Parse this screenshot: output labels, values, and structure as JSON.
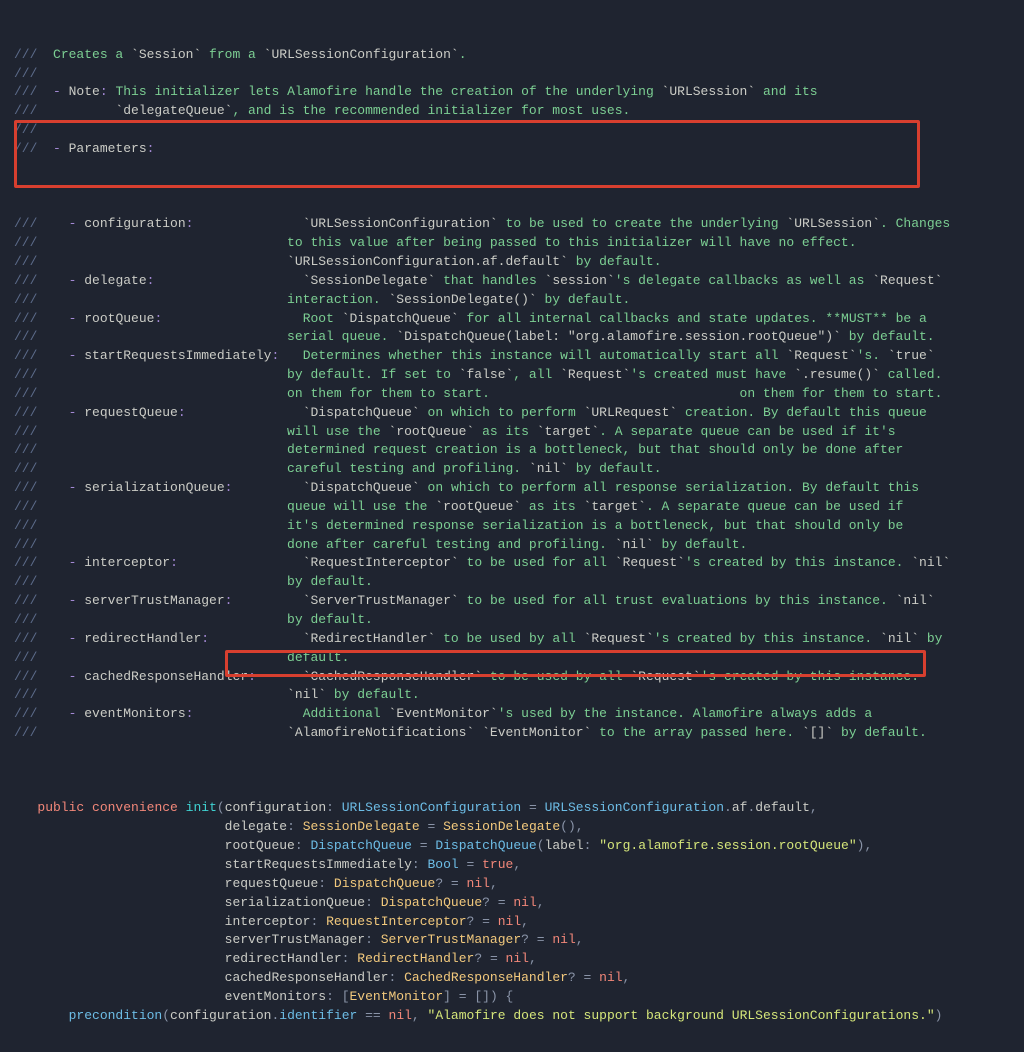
{
  "header": {
    "l1_a": "///",
    "l1_b": "Creates a ",
    "l1_c": "`Session`",
    "l1_d": " from a ",
    "l1_e": "`URLSessionConfiguration`",
    "l1_f": ".",
    "note_a": "///  ",
    "note_dash": "-",
    "note_b": " Note",
    "note_colon": ":",
    "note_c": " This initializer lets Alamofire handle the creation of the underlying ",
    "note_d": "`URLSession`",
    "note_e": " and its",
    "note2_a": "///          ",
    "note2_b": "`delegateQueue`",
    "note2_c": ", and is the recommended initializer for most uses.",
    "params_a": "///  ",
    "params_dash": "-",
    "params_b": " Parameters",
    "params_colon": ":"
  },
  "params": {
    "cfg_l1_a": "///    ",
    "cfg_l1_dash": "-",
    "cfg_l1_b": " configuration",
    "cfg_l1_colon": ":",
    "cfg_l1_sp": "              ",
    "cfg_l1_c": "`URLSessionConfiguration`",
    "cfg_l1_d": " to be used to create the underlying ",
    "cfg_l1_e": "`URLSession`",
    "cfg_l1_f": ". Changes",
    "cfg_l2_a": "///                                to this value after being passed to this initializer will have no effect.",
    "cfg_l3_a": "///                                ",
    "cfg_l3_b": "`URLSessionConfiguration.af.default`",
    "cfg_l3_c": " by default.",
    "del_l1_a": "///    ",
    "del_l1_dash": "-",
    "del_l1_b": " delegate",
    "del_l1_colon": ":",
    "del_l1_sp": "                   ",
    "del_l1_c": "`SessionDelegate`",
    "del_l1_d": " that handles ",
    "del_l1_e": "`session`",
    "del_l1_f": "'s delegate callbacks as well as ",
    "del_l1_g": "`Request`",
    "del_l2_a": "///                                interaction. ",
    "del_l2_b": "`SessionDelegate()`",
    "del_l2_c": " by default.",
    "rq_l1_a": "///    ",
    "rq_l1_dash": "-",
    "rq_l1_b": " rootQueue",
    "rq_l1_colon": ":",
    "rq_l1_sp": "                  ",
    "rq_l1_c": "Root ",
    "rq_l1_d": "`DispatchQueue`",
    "rq_l1_e": " for all internal callbacks and state updates. **MUST** be a",
    "rq_l2_a": "///                                serial queue. ",
    "rq_l2_b": "`DispatchQueue(label: \"org.alamofire.session.rootQueue\")`",
    "rq_l2_c": " by default.",
    "sri_l1_a": "///    ",
    "sri_l1_dash": "-",
    "sri_l1_b": " startRequestsImmediately",
    "sri_l1_colon": ":",
    "sri_l1_sp": "   ",
    "sri_l1_c": "Determines whether this instance will automatically start all ",
    "sri_l1_d": "`Request`",
    "sri_l1_e": "'s. ",
    "sri_l1_f": "`true`",
    "sri_l2_a": "///                                by default. If set to ",
    "sri_l2_b": "`false`",
    "sri_l2_c": ", all ",
    "sri_l2_d": "`Request`",
    "sri_l2_e": "'s created must have ",
    "sri_l2_f": "`.resume()`",
    "sri_l2_g": " called.",
    "sri_l3_a": "///                                on them for them to start.",
    "reqq_l1_a": "///    ",
    "reqq_l1_dash": "-",
    "reqq_l1_b": " requestQueue",
    "reqq_l1_colon": ":",
    "reqq_l1_sp": "               ",
    "reqq_l1_c": "`DispatchQueue`",
    "reqq_l1_d": " on which to perform ",
    "reqq_l1_e": "`URLRequest`",
    "reqq_l1_f": " creation. By default this queue",
    "reqq_l2_a": "///                                will use the ",
    "reqq_l2_b": "`rootQueue`",
    "reqq_l2_c": " as its ",
    "reqq_l2_d": "`target`",
    "reqq_l2_e": ". A separate queue can be used if it's",
    "reqq_l3_a": "///                                determined request creation is a bottleneck, but that should only be done after",
    "reqq_l4_a": "///                                careful testing and profiling. ",
    "reqq_l4_b": "`nil`",
    "reqq_l4_c": " by default.",
    "serq_l1_a": "///    ",
    "serq_l1_dash": "-",
    "serq_l1_b": " serializationQueue",
    "serq_l1_colon": ":",
    "serq_l1_sp": "         ",
    "serq_l1_c": "`DispatchQueue`",
    "serq_l1_d": " on which to perform all response serialization. By default this",
    "serq_l2_a": "///                                queue will use the ",
    "serq_l2_b": "`rootQueue`",
    "serq_l2_c": " as its ",
    "serq_l2_d": "`target`",
    "serq_l2_e": ". A separate queue can be used if",
    "serq_l3_a": "///                                it's determined response serialization is a bottleneck, but that should only be",
    "serq_l4_a": "///                                done after careful testing and profiling. ",
    "serq_l4_b": "`nil`",
    "serq_l4_c": " by default.",
    "int_l1_a": "///    ",
    "int_l1_dash": "-",
    "int_l1_b": " interceptor",
    "int_l1_colon": ":",
    "int_l1_sp": "                ",
    "int_l1_c": "`RequestInterceptor`",
    "int_l1_d": " to be used for all ",
    "int_l1_e": "`Request`",
    "int_l1_f": "'s created by this instance. ",
    "int_l1_g": "`nil`",
    "int_l2_a": "///                                by default.",
    "stm_l1_a": "///    ",
    "stm_l1_dash": "-",
    "stm_l1_b": " serverTrustManager",
    "stm_l1_colon": ":",
    "stm_l1_sp": "         ",
    "stm_l1_c": "`ServerTrustManager`",
    "stm_l1_d": " to be used for all trust evaluations by this instance. ",
    "stm_l1_e": "`nil`",
    "stm_l2_a": "///                                by default.",
    "rh_l1_a": "///    ",
    "rh_l1_dash": "-",
    "rh_l1_b": " redirectHandler",
    "rh_l1_colon": ":",
    "rh_l1_sp": "            ",
    "rh_l1_c": "`RedirectHandler`",
    "rh_l1_d": " to be used by all ",
    "rh_l1_e": "`Request`",
    "rh_l1_f": "'s created by this instance. ",
    "rh_l1_g": "`nil`",
    "rh_l1_h": " by",
    "rh_l2_a": "///                                default.",
    "crh_l1_a": "///    ",
    "crh_l1_dash": "-",
    "crh_l1_b": " cachedResponseHandler",
    "crh_l1_colon": ":",
    "crh_l1_sp": "      ",
    "crh_l1_c": "`CachedResponseHandler`",
    "crh_l1_d": " to be used by all ",
    "crh_l1_e": "`Request`",
    "crh_l1_f": "'s created by this instance.",
    "crh_l2_a": "///                                ",
    "crh_l2_b": "`nil`",
    "crh_l2_c": " by default.",
    "em_l1_a": "///    ",
    "em_l1_dash": "-",
    "em_l1_b": " eventMonitors",
    "em_l1_colon": ":",
    "em_l1_sp": "              ",
    "em_l1_c": "Additional ",
    "em_l1_d": "`EventMonitor`",
    "em_l1_e": "'s used by the instance. Alamofire always adds a",
    "em_l2_a": "///                                ",
    "em_l2_b": "`AlamofireNotifications`",
    "em_l2_c": " ",
    "em_l2_d": "`EventMonitor`",
    "em_l2_e": " to the array passed here. ",
    "em_l2_f": "`[]`",
    "em_l2_g": " by default."
  },
  "code": {
    "l1_a": "   ",
    "l1_public": "public",
    "l1_b": " ",
    "l1_convenience": "convenience",
    "l1_c": " ",
    "l1_init": "init",
    "l1_d": "(",
    "l1_cfg": "configuration",
    "l1_colon": ":",
    "l1_sp": " ",
    "l1_type": "URLSessionConfiguration",
    "l1_eq": " = ",
    "l1_type2": "URLSessionConfiguration",
    "l1_dot": ".",
    "l1_af": "af",
    "l1_dot2": ".",
    "l1_default": "default",
    "l1_comma": ",",
    "l2_a": "                           ",
    "l2_name": "delegate",
    "l2_colon": ":",
    "l2_sp": " ",
    "l2_type": "SessionDelegate",
    "l2_eq": " = ",
    "l2_fn": "SessionDelegate",
    "l2_paren": "(),",
    "l3_a": "                           ",
    "l3_name": "rootQueue",
    "l3_colon": ":",
    "l3_sp": " ",
    "l3_type": "DispatchQueue",
    "l3_eq": " = ",
    "l3_fn": "DispatchQueue",
    "l3_p1": "(",
    "l3_arg": "label",
    "l3_c2": ":",
    "l3_sp2": " ",
    "l3_str": "\"org.alamofire.session.rootQueue\"",
    "l3_p2": "),",
    "l4_a": "                           ",
    "l4_name": "startRequestsImmediately",
    "l4_colon": ":",
    "l4_sp": " ",
    "l4_type": "Bool",
    "l4_eq": " = ",
    "l4_val": "true",
    "l4_comma": ",",
    "l5_a": "                           ",
    "l5_name": "requestQueue",
    "l5_colon": ":",
    "l5_sp": " ",
    "l5_type": "DispatchQueue",
    "l5_q": "?",
    "l5_eq": " = ",
    "l5_val": "nil",
    "l5_comma": ",",
    "l6_a": "                           ",
    "l6_name": "serializationQueue",
    "l6_colon": ":",
    "l6_sp": " ",
    "l6_type": "DispatchQueue",
    "l6_q": "?",
    "l6_eq": " = ",
    "l6_val": "nil",
    "l6_comma": ",",
    "l7_a": "                           ",
    "l7_name": "interceptor",
    "l7_colon": ":",
    "l7_sp": " ",
    "l7_type": "RequestInterceptor",
    "l7_q": "?",
    "l7_eq": " = ",
    "l7_val": "nil",
    "l7_comma": ",",
    "l8_a": "                           ",
    "l8_name": "serverTrustManager",
    "l8_colon": ":",
    "l8_sp": " ",
    "l8_type": "ServerTrustManager",
    "l8_q": "?",
    "l8_eq": " = ",
    "l8_val": "nil",
    "l8_comma": ",",
    "l9_a": "                           ",
    "l9_name": "redirectHandler",
    "l9_colon": ":",
    "l9_sp": " ",
    "l9_type": "RedirectHandler",
    "l9_q": "?",
    "l9_eq": " = ",
    "l9_val": "nil",
    "l9_comma": ",",
    "l10_a": "                           ",
    "l10_name": "cachedResponseHandler",
    "l10_colon": ":",
    "l10_sp": " ",
    "l10_type": "CachedResponseHandler",
    "l10_q": "?",
    "l10_eq": " = ",
    "l10_val": "nil",
    "l10_comma": ",",
    "l11_a": "                           ",
    "l11_name": "eventMonitors",
    "l11_colon": ":",
    "l11_sp": " ",
    "l11_b1": "[",
    "l11_type": "EventMonitor",
    "l11_b2": "]",
    "l11_eq": " = ",
    "l11_val": "[]) {",
    "l12_a": "       ",
    "l12_fn": "precondition",
    "l12_p1": "(",
    "l12_nm": "configuration",
    "l12_dot": ".",
    "l12_id": "identifier",
    "l12_eq": " == ",
    "l12_nil": "nil",
    "l12_c": ", ",
    "l12_str": "\"Alamofire does not support background URLSessionConfigurations.\"",
    "l12_p2": ")"
  },
  "slash3": "///"
}
